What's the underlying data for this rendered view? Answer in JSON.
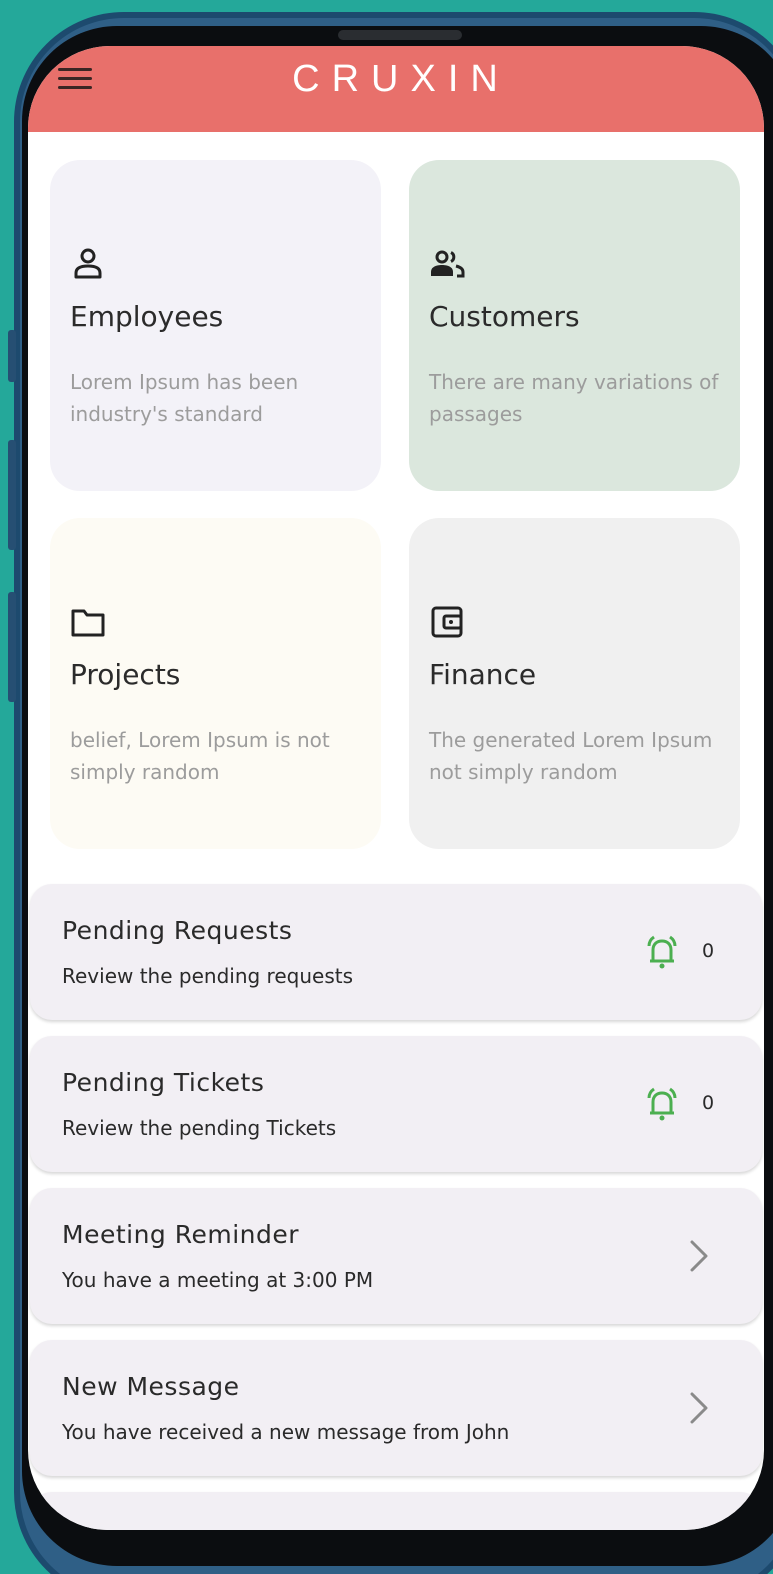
{
  "app": {
    "title": "CRUXIN"
  },
  "colors": {
    "header": "#e8706b",
    "accent_green": "#4caf50",
    "card_employees": "#f3f2f8",
    "card_customers": "#dbe7dd",
    "card_projects": "#fdfbf4",
    "card_finance": "#f0f0f0"
  },
  "cards": [
    {
      "icon": "person-icon",
      "title": "Employees",
      "description": "Lorem Ipsum has been industry's standard"
    },
    {
      "icon": "people-icon",
      "title": "Customers",
      "description": "There are many variations of passages"
    },
    {
      "icon": "folder-icon",
      "title": "Projects",
      "description": "belief, Lorem Ipsum is not simply random"
    },
    {
      "icon": "wallet-icon",
      "title": "Finance",
      "description": "The generated Lorem Ipsum not simply random"
    }
  ],
  "list": [
    {
      "title": "Pending Requests",
      "subtitle": "Review the pending requests",
      "icon": "alarm-bell-icon",
      "count": "0"
    },
    {
      "title": "Pending Tickets",
      "subtitle": "Review the pending Tickets",
      "icon": "alarm-bell-icon",
      "count": "0"
    },
    {
      "title": "Meeting Reminder",
      "subtitle": "You have a meeting at 3:00 PM",
      "icon": "chevron-right-icon"
    },
    {
      "title": "New Message",
      "subtitle": "You have received a new message from John",
      "icon": "chevron-right-icon"
    }
  ]
}
